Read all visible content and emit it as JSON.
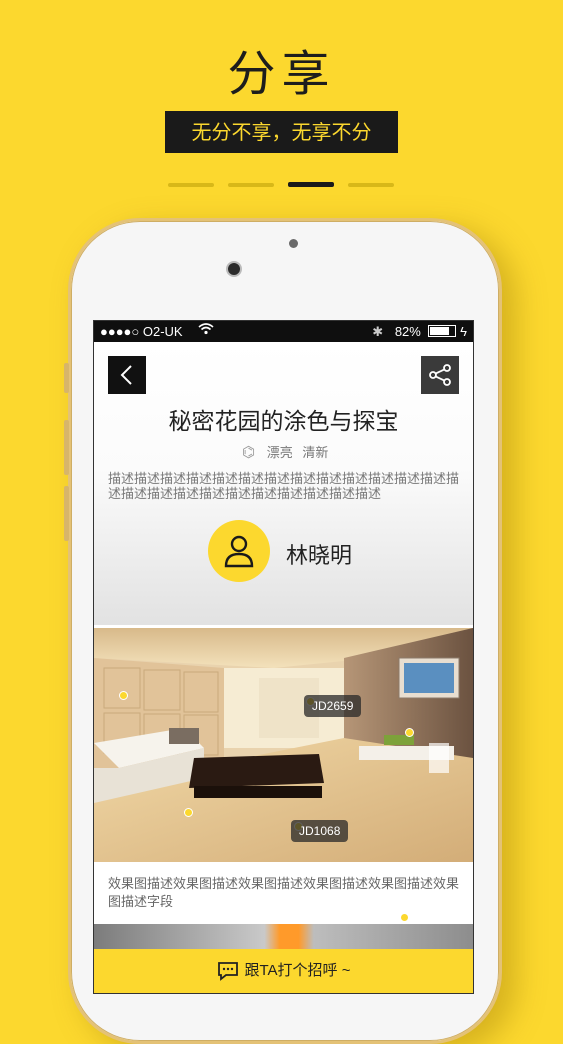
{
  "hero": {
    "title": "分享",
    "subtitle": "无分不享，无享不分"
  },
  "pager": {
    "count": 4,
    "active_index": 2
  },
  "status_bar": {
    "carrier": "●●●●○ O2-UK",
    "battery": "82%",
    "bluetooth": "bluetooth-icon"
  },
  "article": {
    "back_icon": "chevron-left-icon",
    "share_icon": "share-icon",
    "title": "秘密花园的涂色与探宝",
    "tag_icon": "tag-icon",
    "tags": [
      "漂亮",
      "清新"
    ],
    "description": "描述描述描述描述描述描述描述描述描述描述描述描述描述描述描述描述描述描述描述描述描述描述描述描述",
    "author_icon": "user-icon",
    "author_name": "林晓明"
  },
  "photo": {
    "product_tags": [
      "JD2659",
      "JD1068"
    ],
    "description": "效果图描述效果图描述效果图描述效果图描述效果图描述效果图描述字段"
  },
  "bottom_bar": {
    "icon": "chat-icon",
    "label": "跟TA打个招呼 ~"
  },
  "colors": {
    "brand_yellow": "#fcd82e",
    "dark": "#1a1a1a"
  }
}
